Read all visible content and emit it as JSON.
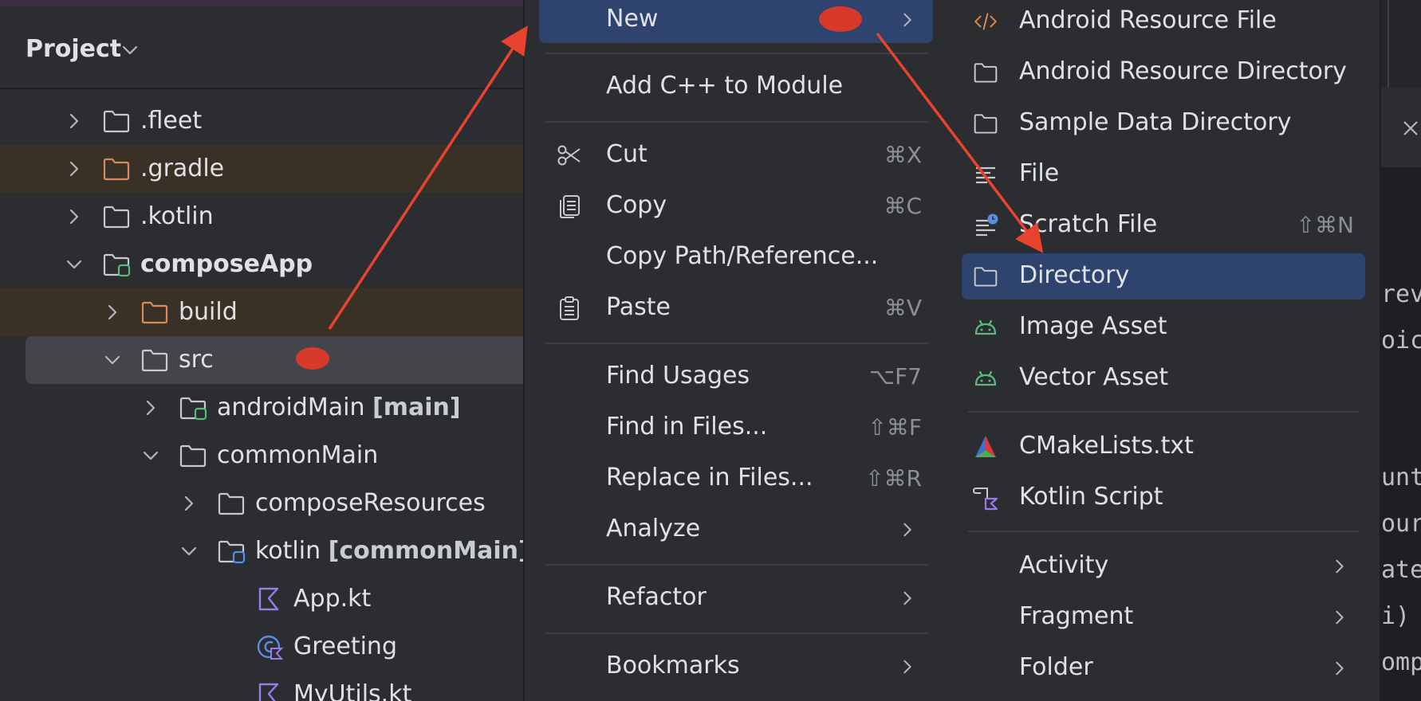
{
  "colors": {
    "panel_bg": "#2b2d30",
    "highlight": "#2e436e",
    "selected_row": "#43454a",
    "ignored_row": "#3a3126",
    "annotation_red": "#e8432f"
  },
  "project_panel": {
    "title": "Project",
    "tree": [
      {
        "label": ".fleet",
        "icon": "folder-icon",
        "expanded": false
      },
      {
        "label": ".gradle",
        "icon": "excluded-folder-icon",
        "expanded": false
      },
      {
        "label": ".kotlin",
        "icon": "folder-icon",
        "expanded": false
      },
      {
        "label": "composeApp",
        "icon": "module-folder-icon",
        "expanded": true
      },
      {
        "label": "build",
        "icon": "excluded-folder-icon",
        "expanded": false
      },
      {
        "label": "src",
        "icon": "folder-icon",
        "expanded": true,
        "selected": true
      },
      {
        "label": "androidMain",
        "tag": "[main]",
        "icon": "source-set-folder-icon",
        "expanded": false
      },
      {
        "label": "commonMain",
        "icon": "folder-icon",
        "expanded": true
      },
      {
        "label": "composeResources",
        "icon": "folder-icon",
        "expanded": false
      },
      {
        "label": "kotlin",
        "tag": "[commonMain]",
        "icon": "source-root-folder-icon",
        "expanded": true
      },
      {
        "label": "App.kt",
        "icon": "kotlin-file-icon"
      },
      {
        "label": "Greeting",
        "icon": "kotlin-class-icon"
      },
      {
        "label": "MyUtils.kt",
        "icon": "kotlin-file-icon"
      }
    ]
  },
  "context_menu": {
    "items": [
      {
        "label": "New",
        "shortcut": "",
        "submenu": true,
        "highlighted": true
      },
      {
        "label": "Add C++ to Module",
        "shortcut": ""
      },
      {
        "label": "Cut",
        "shortcut": "⌘X",
        "icon": "scissors-icon"
      },
      {
        "label": "Copy",
        "shortcut": "⌘C",
        "icon": "copy-icon"
      },
      {
        "label": "Copy Path/Reference...",
        "shortcut": ""
      },
      {
        "label": "Paste",
        "shortcut": "⌘V",
        "icon": "clipboard-icon"
      },
      {
        "label": "Find Usages",
        "shortcut": "⌥F7"
      },
      {
        "label": "Find in Files...",
        "shortcut": "⇧⌘F"
      },
      {
        "label": "Replace in Files...",
        "shortcut": "⇧⌘R"
      },
      {
        "label": "Analyze",
        "shortcut": "",
        "submenu": true
      },
      {
        "label": "Refactor",
        "shortcut": "",
        "submenu": true
      },
      {
        "label": "Bookmarks",
        "shortcut": "",
        "submenu": true
      }
    ]
  },
  "new_submenu": {
    "items": [
      {
        "label": "Android Resource File",
        "icon": "xml-code-icon"
      },
      {
        "label": "Android Resource Directory",
        "icon": "folder-icon"
      },
      {
        "label": "Sample Data Directory",
        "icon": "folder-icon"
      },
      {
        "label": "File",
        "icon": "text-file-icon"
      },
      {
        "label": "Scratch File",
        "icon": "scratch-file-icon",
        "shortcut": "⇧⌘N"
      },
      {
        "label": "Directory",
        "icon": "folder-icon",
        "highlighted": true
      },
      {
        "label": "Image Asset",
        "icon": "android-icon"
      },
      {
        "label": "Vector Asset",
        "icon": "android-icon"
      },
      {
        "label": "CMakeLists.txt",
        "icon": "cmake-icon"
      },
      {
        "label": "Kotlin Script",
        "icon": "kotlin-script-icon"
      },
      {
        "label": "Activity",
        "submenu": true
      },
      {
        "label": "Fragment",
        "submenu": true
      },
      {
        "label": "Folder",
        "submenu": true
      }
    ]
  },
  "editor": {
    "code_fragments": [
      "rev",
      "oic",
      "unt",
      "our",
      "ate",
      "i)",
      "omp"
    ]
  }
}
